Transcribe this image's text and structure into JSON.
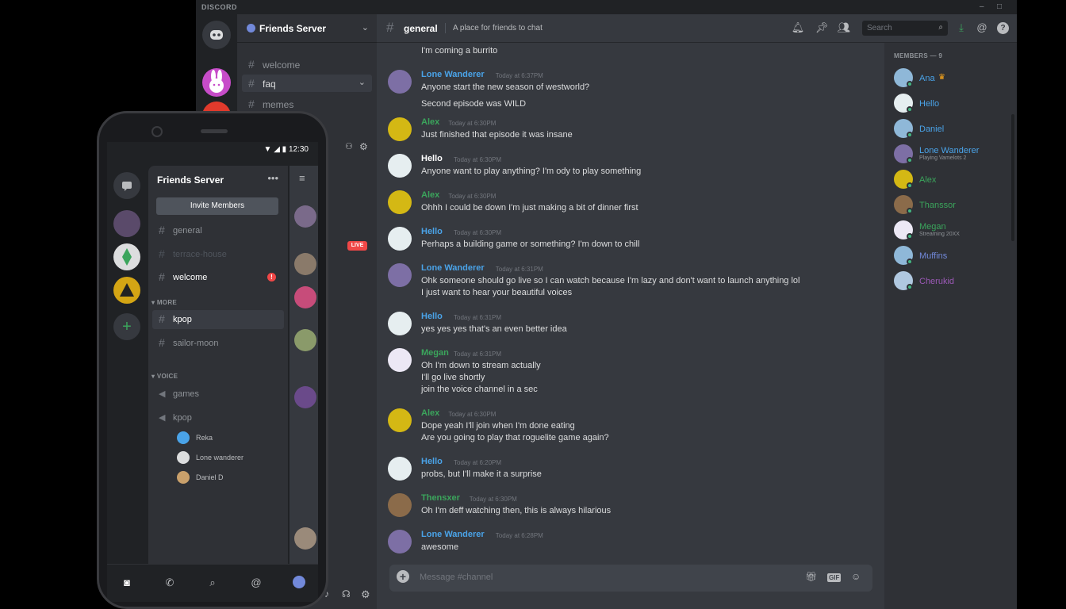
{
  "window": {
    "title": "DISCORD",
    "minimize": "–",
    "maximize": "□"
  },
  "server": {
    "name": "Friends Server",
    "channels": [
      {
        "name": "welcome"
      },
      {
        "name": "faq"
      },
      {
        "name": "memes"
      }
    ]
  },
  "channel": {
    "name": "general",
    "topic": "A place for friends to chat"
  },
  "search": {
    "placeholder": "Search"
  },
  "messages": [
    {
      "author": "",
      "color": "",
      "time": "",
      "lines": [
        "I'm coming a burrito"
      ]
    },
    {
      "author": "Lone Wanderer",
      "color": "#4aa3e8",
      "time": "Today at 6:37PM",
      "lines": [
        "Anyone start the new season of westworld?",
        "Second episode was WILD"
      ]
    },
    {
      "author": "Alex",
      "color": "#3ba55c",
      "time": "Today at 6:30PM",
      "lines": [
        "Just finished that episode it was insane"
      ]
    },
    {
      "author": "Hello",
      "color": "#ffffff",
      "time": "Today at 6:30PM",
      "lines": [
        "Anyone want to play anything? I'm ody to play something"
      ]
    },
    {
      "author": "Alex",
      "color": "#3ba55c",
      "time": "Today at 6:30PM",
      "lines": [
        "Ohhh I could be down I'm just making a bit of dinner first"
      ]
    },
    {
      "author": "Hello",
      "color": "#4aa3e8",
      "time": "Today at 6:30PM",
      "lines": [
        "Perhaps a building game or something? I'm down to chill"
      ]
    },
    {
      "author": "Lone Wanderer",
      "color": "#4aa3e8",
      "time": "Today at 6:31PM",
      "lines": [
        "Ohk someone should go live so I can watch because I'm lazy and don't want to launch anything lol",
        "I just want to hear your beautiful voices"
      ]
    },
    {
      "author": "Hello",
      "color": "#4aa3e8",
      "time": "Today at 6:31PM",
      "lines": [
        "yes yes yes that's an even better idea"
      ]
    },
    {
      "author": "Megan",
      "color": "#3ba55c",
      "time": "Today at 6:31PM",
      "lines": [
        "Oh I'm down to stream actually",
        "I'll go live shortly",
        "join the voice channel in a sec"
      ]
    },
    {
      "author": "Alex",
      "color": "#3ba55c",
      "time": "Today at 6:30PM",
      "lines": [
        "Dope yeah I'll join when I'm done eating",
        "Are you going to play that roguelite game again?"
      ]
    },
    {
      "author": "Hello",
      "color": "#4aa3e8",
      "time": "Today at 6:20PM",
      "lines": [
        "probs, but I'll make it a surprise"
      ]
    },
    {
      "author": "Thensxer",
      "color": "#3ba55c",
      "time": "Today at 6:30PM",
      "lines": [
        "Oh I'm deff watching then, this is always hilarious"
      ]
    },
    {
      "author": "Lone Wanderer",
      "color": "#4aa3e8",
      "time": "Today at 6:28PM",
      "lines": [
        "awesome"
      ]
    }
  ],
  "composer": {
    "placeholder": "Message #channel"
  },
  "members": {
    "header": "MEMBERS — 9",
    "list": [
      {
        "name": "Ana",
        "color": "#4aa3e8",
        "status": ""
      },
      {
        "name": "Hello",
        "color": "#4aa3e8",
        "status": ""
      },
      {
        "name": "Daniel",
        "color": "#4aa3e8",
        "status": ""
      },
      {
        "name": "Lone Wanderer",
        "color": "#4aa3e8",
        "status": "Playing Vamelots 2"
      },
      {
        "name": "Alex",
        "color": "#3ba55c",
        "status": ""
      },
      {
        "name": "Thanssor",
        "color": "#3ba55c",
        "status": ""
      },
      {
        "name": "Megan",
        "color": "#3ba55c",
        "status": "Streaming 20XX"
      },
      {
        "name": "Muffins",
        "color": "#7289da",
        "status": ""
      },
      {
        "name": "Cherukid",
        "color": "#9b59b6",
        "status": ""
      }
    ]
  },
  "phone": {
    "time": "12:30",
    "server_name": "Friends Server",
    "invite_label": "Invite Members",
    "channels": [
      {
        "name": "general"
      },
      {
        "name": "terrace-house"
      },
      {
        "name": "welcome",
        "badge": "!"
      }
    ],
    "more_label": "MORE",
    "more_channels": [
      {
        "name": "kpop"
      },
      {
        "name": "sailor-moon"
      }
    ],
    "voice_label": "VOICE",
    "voice_channels": [
      {
        "name": "games"
      },
      {
        "name": "kpop"
      }
    ],
    "voice_users": [
      {
        "name": "Reka"
      },
      {
        "name": "Lone wanderer"
      },
      {
        "name": "Daniel D"
      }
    ],
    "live_label": "LIVE"
  }
}
